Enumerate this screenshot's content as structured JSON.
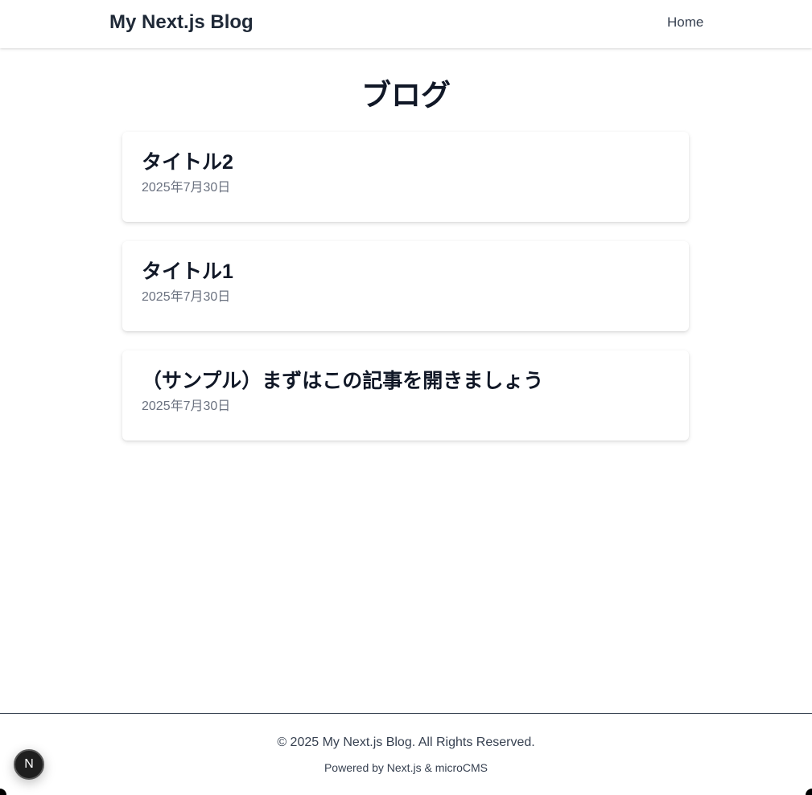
{
  "header": {
    "site_title": "My Next.js Blog",
    "nav": [
      {
        "label": "Home"
      }
    ]
  },
  "main": {
    "page_title": "ブログ",
    "posts": [
      {
        "title": "タイトル2",
        "date": "2025年7月30日"
      },
      {
        "title": "タイトル1",
        "date": "2025年7月30日"
      },
      {
        "title": "（サンプル）まずはこの記事を開きましょう",
        "date": "2025年7月30日"
      }
    ]
  },
  "footer": {
    "copyright": "© 2025 My Next.js Blog. All Rights Reserved.",
    "powered_by": "Powered by Next.js & microCMS"
  },
  "dev_indicator": {
    "glyph": "N",
    "icon": "nextjs-logo-icon"
  },
  "colors": {
    "text_primary": "#111827",
    "text_muted": "#6b7280",
    "background": "#ffffff",
    "indicator_bg": "#1f1f1f"
  }
}
